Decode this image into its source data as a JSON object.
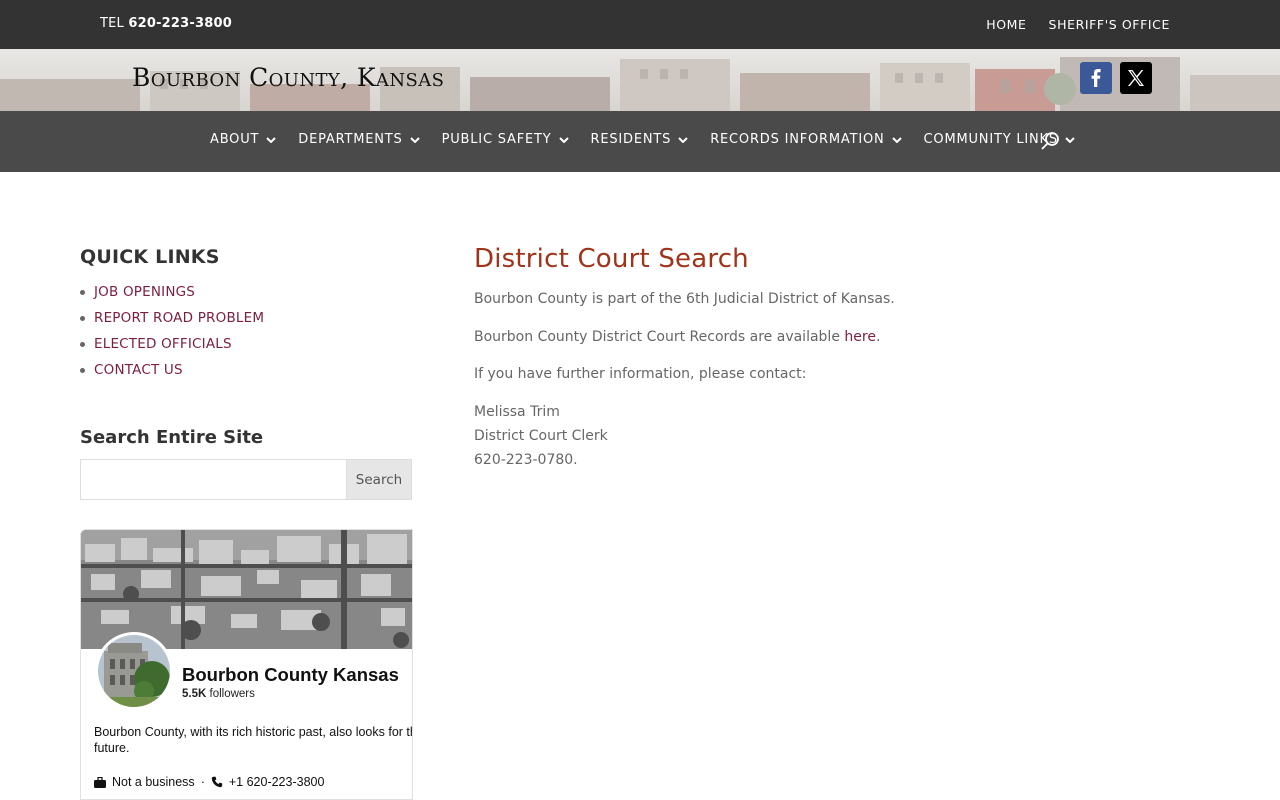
{
  "topbar": {
    "tel_label": "TEL",
    "tel_number": "620-223-3800",
    "links": [
      "HOME",
      "SHERIFF'S OFFICE"
    ]
  },
  "header": {
    "logo_text": "Bourbon County, Kansas",
    "social": [
      "facebook-icon",
      "x-icon"
    ]
  },
  "nav": {
    "items": [
      "ABOUT",
      "DEPARTMENTS",
      "PUBLIC SAFETY",
      "RESIDENTS",
      "RECORDS INFORMATION",
      "COMMUNITY LINKS"
    ]
  },
  "sidebar": {
    "quick_links_title": "QUICK LINKS",
    "quick_links": [
      "JOB OPENINGS",
      "REPORT ROAD PROBLEM",
      "ELECTED OFFICIALS",
      "CONTACT US"
    ],
    "search_title": "Search Entire Site",
    "search_value": "",
    "search_button": "Search"
  },
  "facebook": {
    "page_name": "Bourbon County Kansas",
    "followers_count": "5.5K",
    "followers_label": "followers",
    "about": "Bourbon County, with its rich historic past, also looks for the future.",
    "category": "Not a business",
    "separator": "·",
    "phone": "+1 620-223-3800"
  },
  "content": {
    "title": "District Court Search",
    "p1": "Bourbon County is part of the 6th Judicial District of Kansas.",
    "p2_prefix": "Bourbon County District Court Records are available ",
    "p2_link": "here",
    "p2_suffix": ".",
    "p3": "If you have further information, please contact:",
    "contact_name": "Melissa Trim",
    "contact_title": "District Court Clerk",
    "contact_phone": "620-223-0780."
  },
  "colors": {
    "topbar": "#333333",
    "nav": "#4a4a4a",
    "link": "#7a1f3d",
    "heading": "#a0341a",
    "facebook": "#3b5998"
  }
}
